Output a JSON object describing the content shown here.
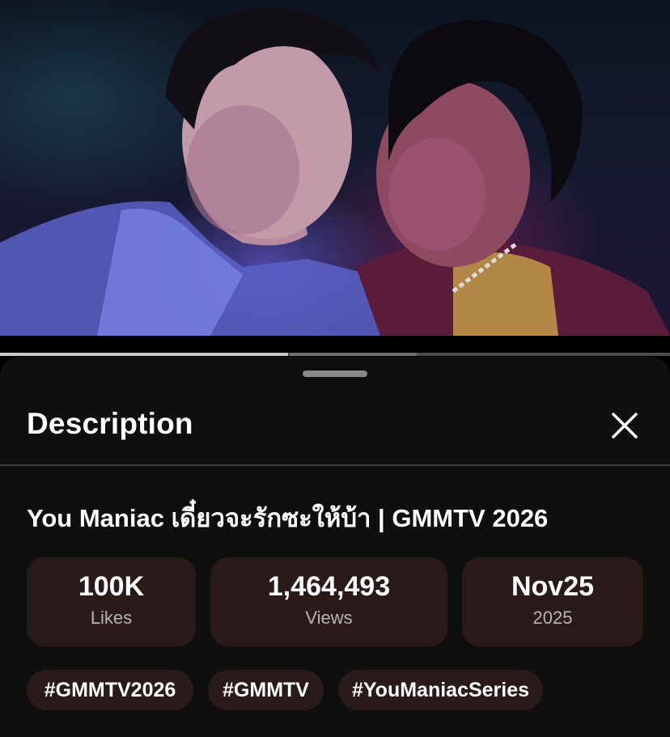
{
  "player": {
    "progress_fraction": 0.43
  },
  "sheet": {
    "title": "Description",
    "close_icon": "close-icon"
  },
  "video": {
    "title": "You Maniac เดี๋ยวจะรักซะให้บ้า | GMMTV 2026"
  },
  "stats": [
    {
      "value": "100K",
      "label": "Likes"
    },
    {
      "value": "1,464,493",
      "label": "Views"
    },
    {
      "value": "Nov25",
      "label": "2025"
    }
  ],
  "hashtags": [
    "#GMMTV2026",
    "#GMMTV",
    "#YouManiacSeries"
  ],
  "colors": {
    "sheet_bg": "#0f0f0f",
    "chip_bg": "#2b1a1a",
    "muted_text": "#b5b5b5"
  }
}
